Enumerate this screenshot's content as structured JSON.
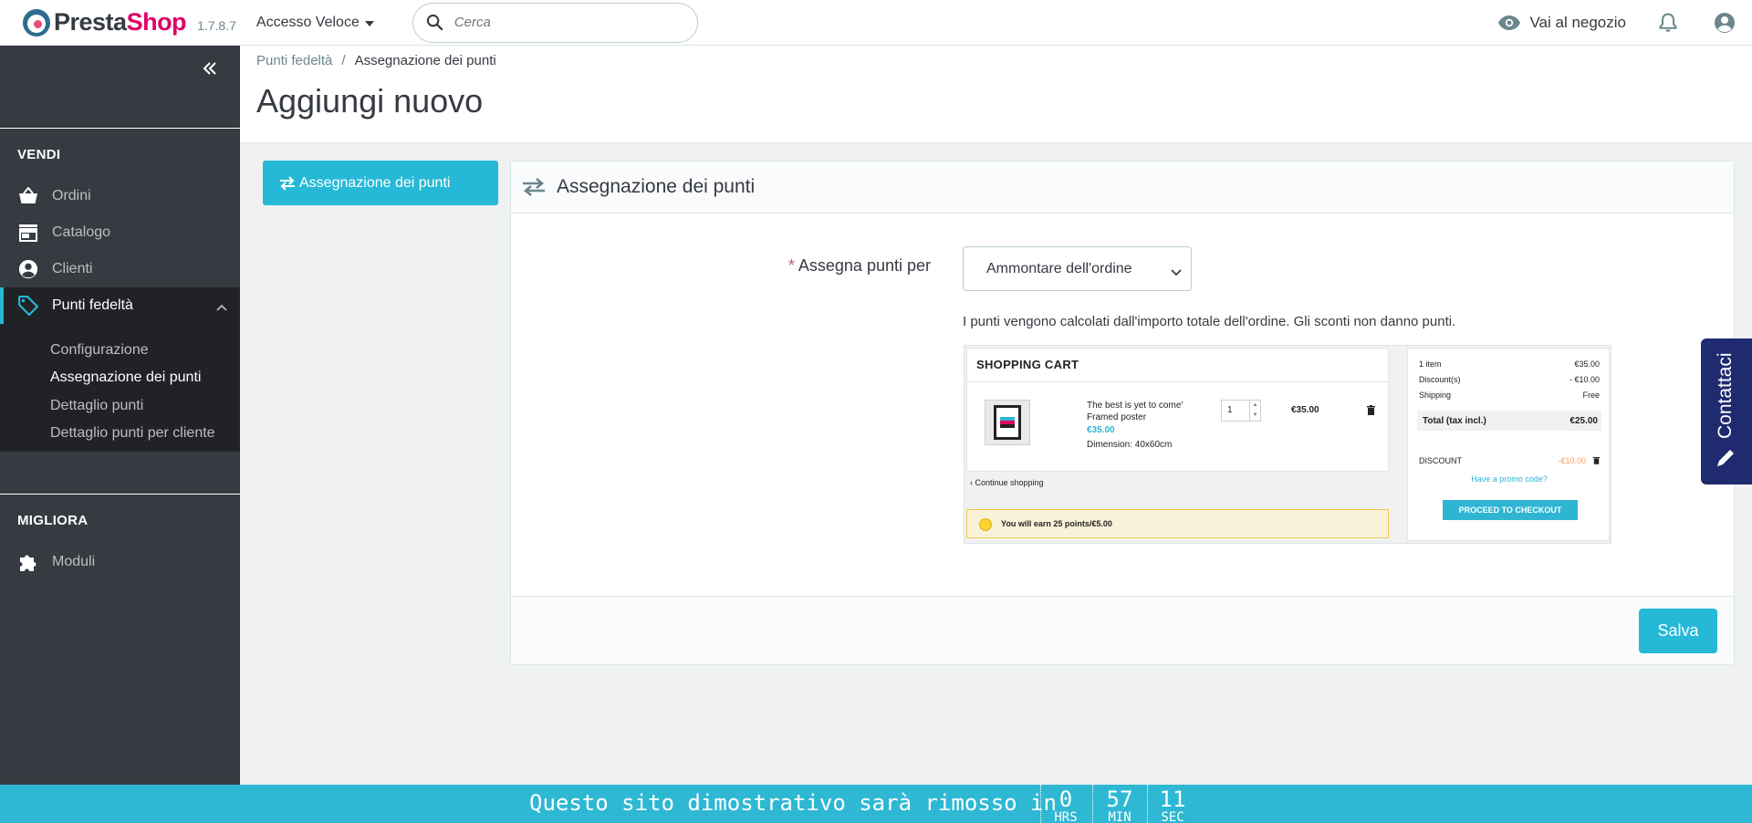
{
  "header": {
    "logo_part1": "Presta",
    "logo_part2": "Shop",
    "version": "1.7.8.7",
    "quick_access": "Accesso Veloce",
    "search_placeholder": "Cerca",
    "view_shop": "Vai al negozio"
  },
  "sidebar": {
    "section_sell": "VENDI",
    "items": [
      {
        "label": "Ordini",
        "icon": "basket-icon"
      },
      {
        "label": "Catalogo",
        "icon": "store-icon"
      },
      {
        "label": "Clienti",
        "icon": "account-circle-icon"
      },
      {
        "label": "Punti fedeltà",
        "icon": "tag-icon"
      }
    ],
    "submenu": [
      "Configurazione",
      "Assegnazione dei punti",
      "Dettaglio punti",
      "Dettaglio punti per cliente"
    ],
    "section_improve": "MIGLIORA",
    "modules": "Moduli"
  },
  "breadcrumb": {
    "parent": "Punti fedeltà",
    "sep": "/",
    "current": "Assegnazione dei punti"
  },
  "page_title": "Aggiungi nuovo",
  "tab_label": "Assegnazione dei punti",
  "panel": {
    "title": "Assegnazione dei punti",
    "field_required": "*",
    "field_label": "Assegna punti per",
    "select_value": "Ammontare dell'ordine",
    "help_text": "I punti vengono calcolati dall'importo totale dell'ordine. Gli sconti non danno punti.",
    "save_label": "Salva"
  },
  "cart_preview": {
    "title": "SHOPPING CART",
    "product_name_1": "The best is yet to come'",
    "product_name_2": "Framed poster",
    "product_price": "€35.00",
    "product_dimension": "Dimension: 40x60cm",
    "qty": "1",
    "line_price": "€35.00",
    "continue": "Continue shopping",
    "earn": "You will earn 25 points/€5.00",
    "summary": [
      {
        "label": "1 item",
        "value": "€35.00"
      },
      {
        "label": "Discount(s)",
        "value": "- €10.00"
      },
      {
        "label": "Shipping",
        "value": "Free"
      }
    ],
    "total_label": "Total (tax incl.)",
    "total_value": "€25.00",
    "discount_label": "DISCOUNT",
    "discount_value": "-€10.00",
    "promo": "Have a promo code?",
    "checkout": "PROCEED TO CHECKOUT"
  },
  "contact_tab": "Contattaci",
  "demo_banner": {
    "text": "Questo sito dimostrativo sarà rimosso in",
    "hours": "0",
    "hours_label": "HRS",
    "minutes": "57",
    "minutes_label": "MIN",
    "seconds": "11",
    "seconds_label": "SEC"
  },
  "colors": {
    "accent": "#25b9d7",
    "sidebar": "#363a41",
    "brand_pink": "#df0067"
  }
}
